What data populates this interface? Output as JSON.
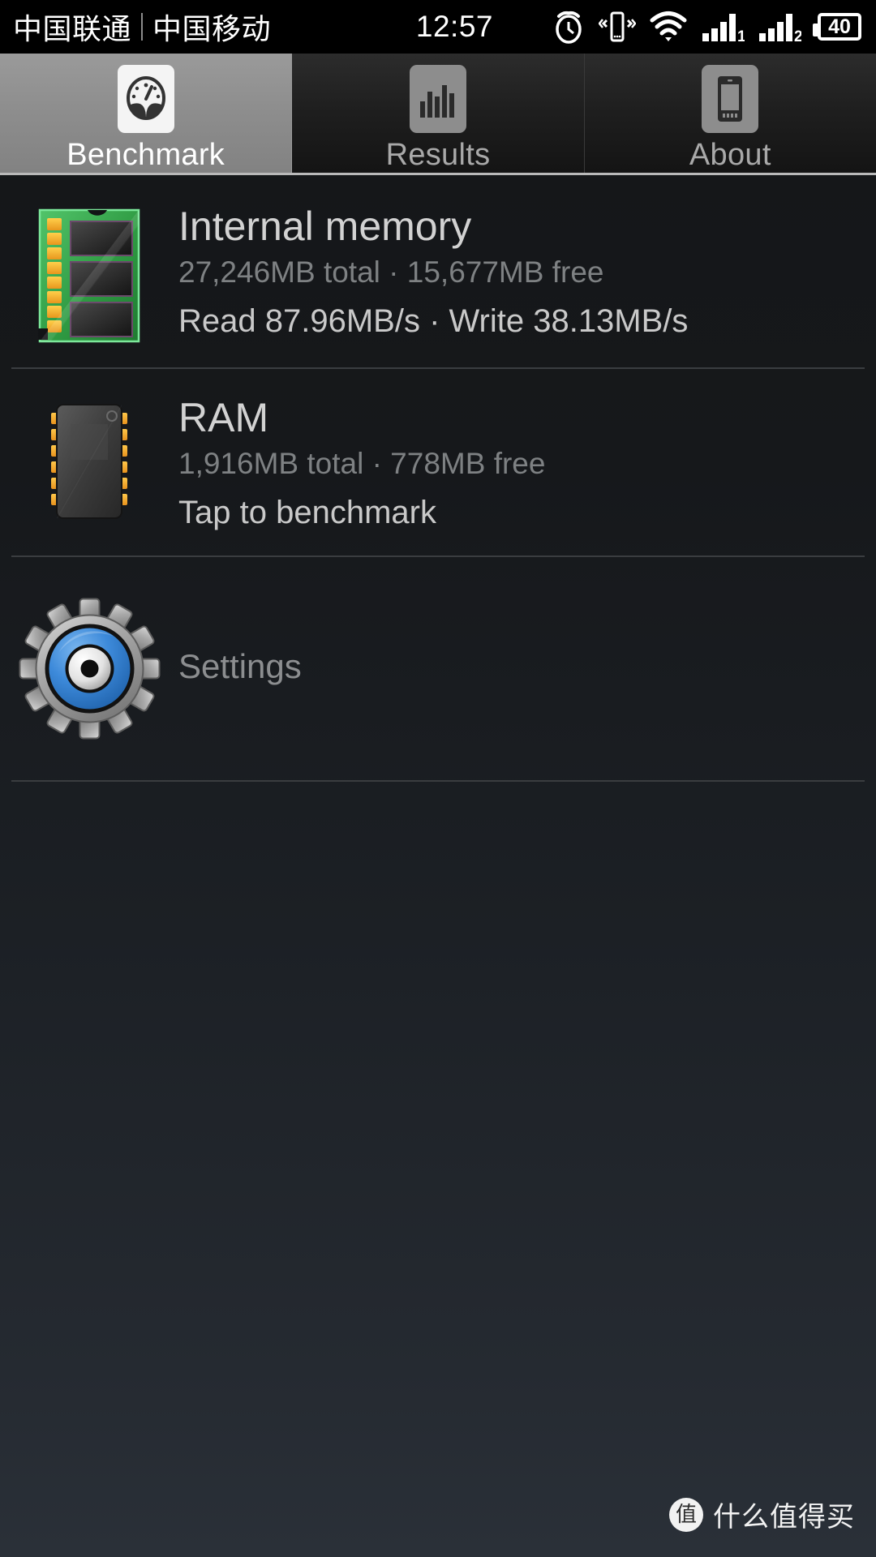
{
  "status_bar": {
    "carrier_primary": "中国联通",
    "carrier_secondary": "中国移动",
    "time": "12:57",
    "icons": [
      "alarm-clock-icon",
      "vibrate-icon",
      "wifi-icon",
      "signal-sim1-icon",
      "signal-sim2-icon"
    ],
    "battery_percent": "40"
  },
  "tabs": [
    {
      "label": "Benchmark",
      "icon": "speedometer-icon",
      "active": true
    },
    {
      "label": "Results",
      "icon": "bar-chart-icon",
      "active": false
    },
    {
      "label": "About",
      "icon": "phone-device-icon",
      "active": false
    }
  ],
  "rows": [
    {
      "id": "internal-memory",
      "icon": "memory-module-icon",
      "title": "Internal memory",
      "subtitle": "27,246MB total · 15,677MB free",
      "action": "Read 87.96MB/s · Write 38.13MB/s"
    },
    {
      "id": "ram",
      "icon": "ram-chip-icon",
      "title": "RAM",
      "subtitle": "1,916MB total · 778MB free",
      "action": "Tap to benchmark"
    }
  ],
  "settings": {
    "icon": "gear-icon",
    "label": "Settings"
  },
  "watermark": {
    "badge": "值",
    "text": "什么值得买"
  },
  "colors": {
    "accent_green": "#3cb54a",
    "accent_orange": "#f5a623",
    "accent_blue": "#2f7fd1",
    "tab_active_bg": "#8e8e8e",
    "text_primary": "#d2d2d2",
    "text_secondary": "#7e8183"
  }
}
